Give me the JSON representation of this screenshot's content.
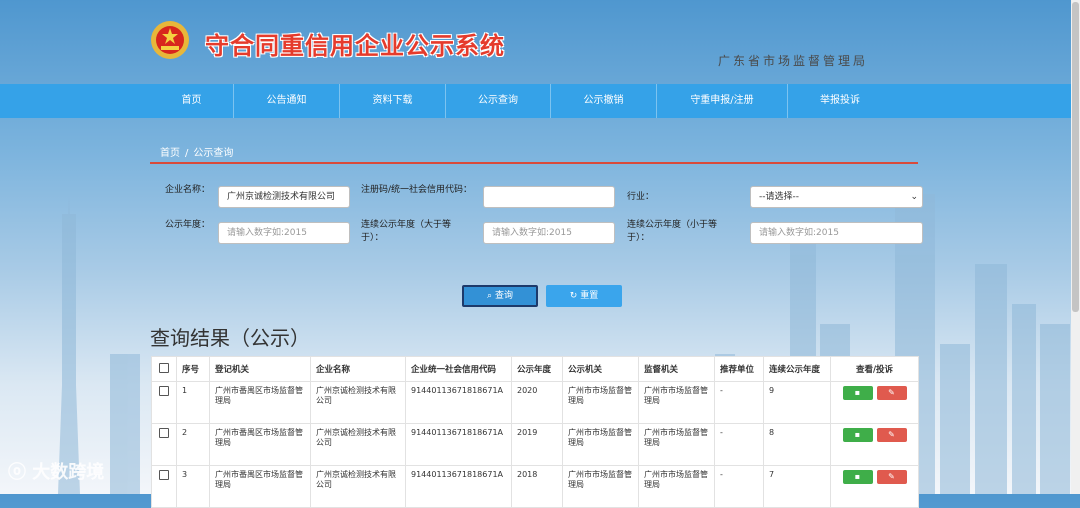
{
  "header": {
    "title": "守合同重信用企业公示系统",
    "agency": "广东省市场监督管理局"
  },
  "nav": [
    "首页",
    "公告通知",
    "资料下载",
    "公示查询",
    "公示撤销",
    "守重申报/注册",
    "举报投诉"
  ],
  "breadcrumb": {
    "home": "首页",
    "sep": "/",
    "current": "公示查询"
  },
  "search": {
    "company_label": "企业名称：",
    "company_value": "广州京诚检测技术有限公司",
    "code_label": "注册码/统一社会信用代码：",
    "code_value": "",
    "industry_label": "行业：",
    "industry_value": "--请选择--",
    "year_label": "公示年度：",
    "year_placeholder": "请输入数字如:2015",
    "ge_label": "连续公示年度（大于等于）：",
    "ge_placeholder": "请输入数字如:2015",
    "le_label": "连续公示年度（小于等于）：",
    "le_placeholder": "请输入数字如:2015",
    "query_label": "查询",
    "reset_label": "重置"
  },
  "results": {
    "title": "查询结果（公示）",
    "columns": [
      "序号",
      "登记机关",
      "企业名称",
      "企业统一社会信用代码",
      "公示年度",
      "公示机关",
      "监督机关",
      "推荐单位",
      "连续公示年度",
      "查看/投诉"
    ],
    "rows": [
      {
        "no": "1",
        "reg": "广州市番禺区市场监督管理局",
        "name": "广州京诚检测技术有限公司",
        "code": "91440113671818671A",
        "year": "2020",
        "pub": "广州市市场监督管理局",
        "sup": "广州市市场监督管理局",
        "rec": "-",
        "cont": "9"
      },
      {
        "no": "2",
        "reg": "广州市番禺区市场监督管理局",
        "name": "广州京诚检测技术有限公司",
        "code": "91440113671818671A",
        "year": "2019",
        "pub": "广州市市场监督管理局",
        "sup": "广州市市场监督管理局",
        "rec": "-",
        "cont": "8"
      },
      {
        "no": "3",
        "reg": "广州市番禺区市场监督管理局",
        "name": "广州京诚检测技术有限公司",
        "code": "91440113671818671A",
        "year": "2018",
        "pub": "广州市市场监督管理局",
        "sup": "广州市市场监督管理局",
        "rec": "-",
        "cont": "7"
      }
    ]
  },
  "watermark": "大数跨境",
  "colors": {
    "nav": "#35a2e8",
    "title": "#e53b2c",
    "query_btn": "#3391d6",
    "view_btn": "#3fae49",
    "complain_btn": "#e05a4e"
  }
}
